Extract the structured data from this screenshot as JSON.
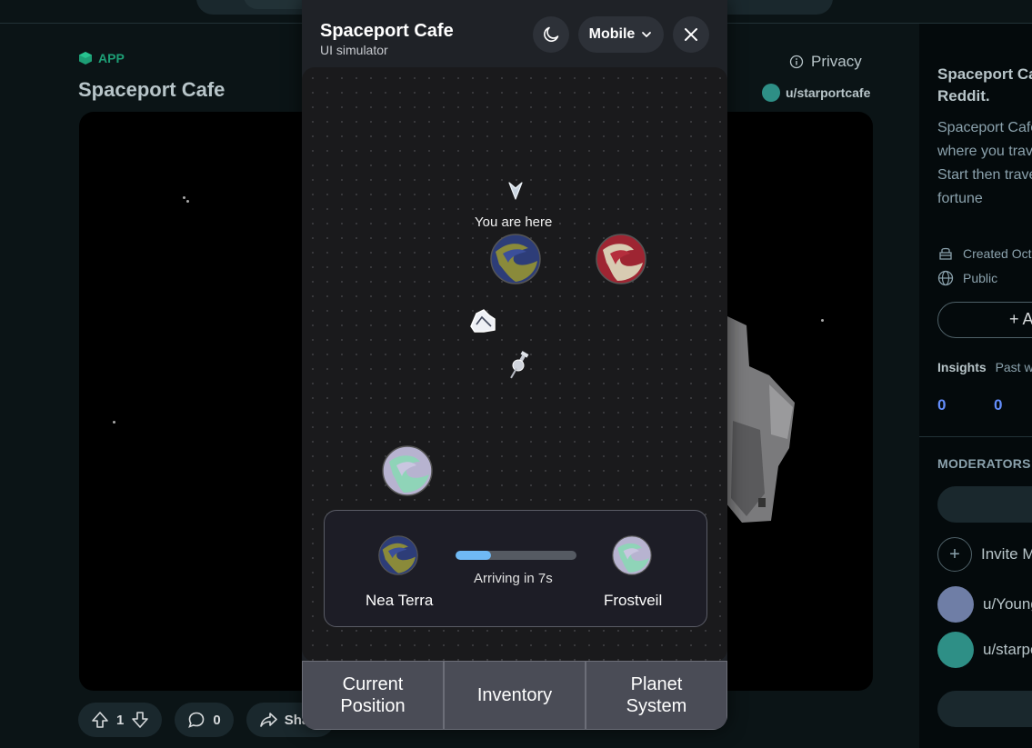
{
  "post": {
    "app_tag": "APP",
    "title": "Spaceport Cafe",
    "privacy_label": "Privacy",
    "author": "u/starportcafe",
    "upvotes": "1",
    "comments": "0",
    "share_label": "Share"
  },
  "sidebar": {
    "title": "Spaceport Cafe on Reddit.",
    "description": "Spaceport Cafe is a game where you travel planets. Start then travel the your fortune",
    "created": "Created Oct",
    "visibility": "Public",
    "add_button": "+ Add",
    "insights_label": "Insights",
    "insights_period": "Past week",
    "insight_values": [
      "0",
      "0"
    ],
    "moderators_label": "MODERATORS",
    "invite_label": "Invite Mod",
    "moderators": [
      "u/Young",
      "u/starportcafe"
    ]
  },
  "simulator": {
    "title": "Spaceport Cafe",
    "subtitle": "UI simulator",
    "device_label": "Mobile",
    "you_are_here": "You are here",
    "trip": {
      "from": "Nea Terra",
      "to": "Frostveil",
      "status": "Arriving in 7s",
      "progress": 0.29
    },
    "tabs": [
      "Current Position",
      "Inventory",
      "Planet System"
    ]
  },
  "colors": {
    "accent_app": "#1d9e75",
    "progress_fill": "#6fb9f5",
    "insight_number": "#648efc"
  }
}
